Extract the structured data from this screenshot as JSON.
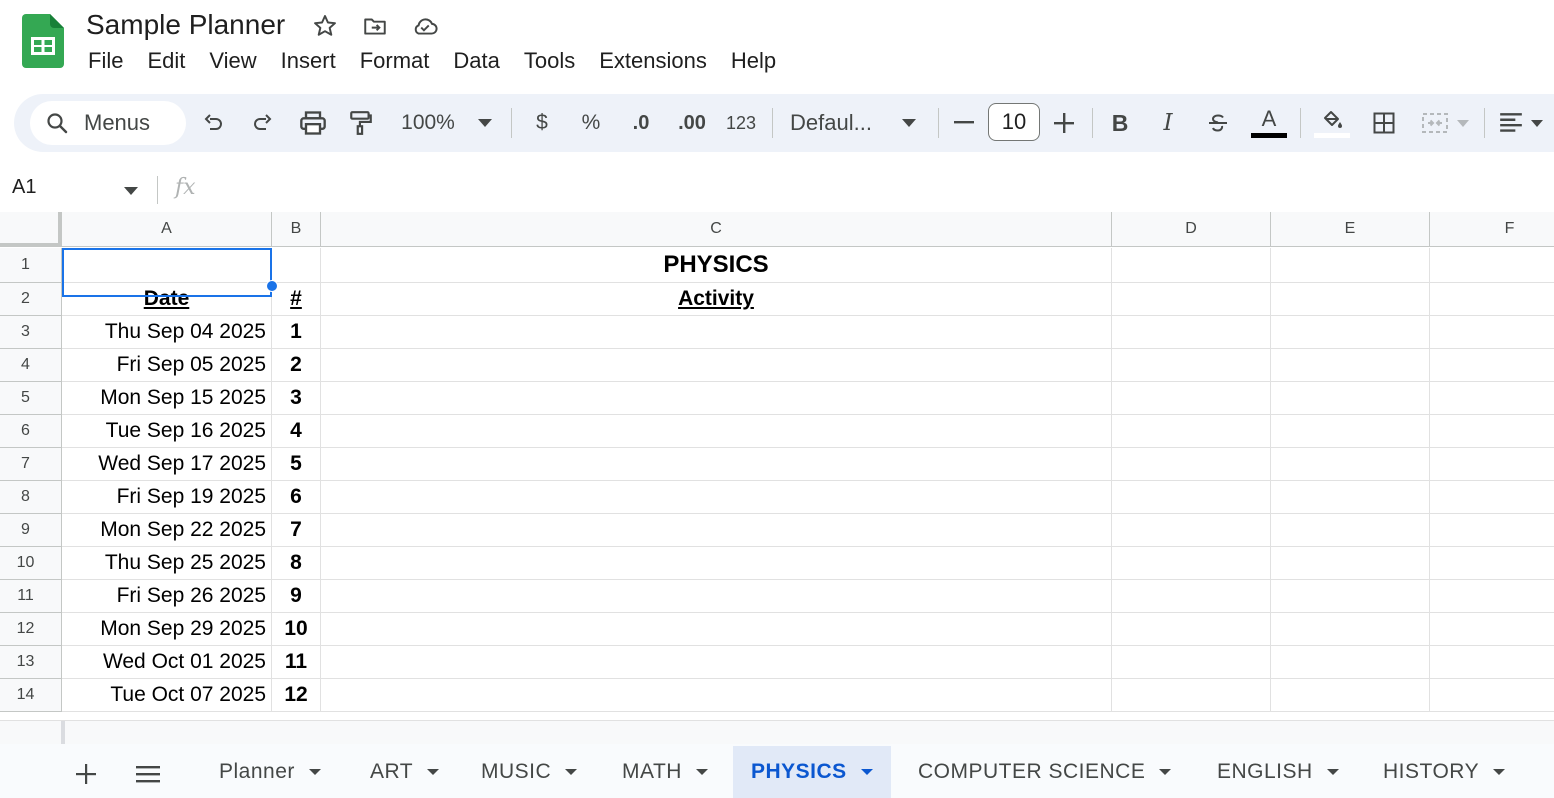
{
  "app": {
    "title": "Sample Planner",
    "menu": [
      "File",
      "Edit",
      "View",
      "Insert",
      "Format",
      "Data",
      "Tools",
      "Extensions",
      "Help"
    ]
  },
  "toolbar": {
    "search_label": "Menus",
    "zoom": "100%",
    "currency": "$",
    "percent": "%",
    "decrease_decimal": ".0",
    "increase_decimal": ".00",
    "number_format": "123",
    "font": "Defaul...",
    "font_size": "10",
    "bold": "B",
    "italic": "I",
    "text_color": "A"
  },
  "formula_bar": {
    "cell_ref": "A1",
    "fx": "fx"
  },
  "columns": [
    "A",
    "B",
    "C",
    "D",
    "E",
    "F"
  ],
  "rows": [
    {
      "num": "1",
      "date": "",
      "idx": "",
      "activity": "PHYSICS"
    },
    {
      "num": "2",
      "date": "Date",
      "idx": "#",
      "activity": "Activity"
    },
    {
      "num": "3",
      "date": "Thu Sep 04 2025",
      "idx": "1",
      "activity": ""
    },
    {
      "num": "4",
      "date": "Fri Sep 05 2025",
      "idx": "2",
      "activity": ""
    },
    {
      "num": "5",
      "date": "Mon Sep 15 2025",
      "idx": "3",
      "activity": ""
    },
    {
      "num": "6",
      "date": "Tue Sep 16 2025",
      "idx": "4",
      "activity": ""
    },
    {
      "num": "7",
      "date": "Wed Sep 17 2025",
      "idx": "5",
      "activity": ""
    },
    {
      "num": "8",
      "date": "Fri Sep 19 2025",
      "idx": "6",
      "activity": ""
    },
    {
      "num": "9",
      "date": "Mon Sep 22 2025",
      "idx": "7",
      "activity": ""
    },
    {
      "num": "10",
      "date": "Thu Sep 25 2025",
      "idx": "8",
      "activity": ""
    },
    {
      "num": "11",
      "date": "Fri Sep 26 2025",
      "idx": "9",
      "activity": ""
    },
    {
      "num": "12",
      "date": "Mon Sep 29 2025",
      "idx": "10",
      "activity": ""
    },
    {
      "num": "13",
      "date": "Wed Oct 01 2025",
      "idx": "11",
      "activity": ""
    },
    {
      "num": "14",
      "date": "Tue Oct 07 2025",
      "idx": "12",
      "activity": ""
    }
  ],
  "sheets": [
    "Planner",
    "ART",
    "MUSIC",
    "MATH",
    "PHYSICS",
    "COMPUTER SCIENCE",
    "ENGLISH",
    "HISTORY"
  ],
  "active_sheet": "PHYSICS",
  "colors": {
    "accent": "#0b57d0",
    "selection": "#1a73e8",
    "logo": "#34a853",
    "toolbar_bg": "#eef2f9"
  }
}
